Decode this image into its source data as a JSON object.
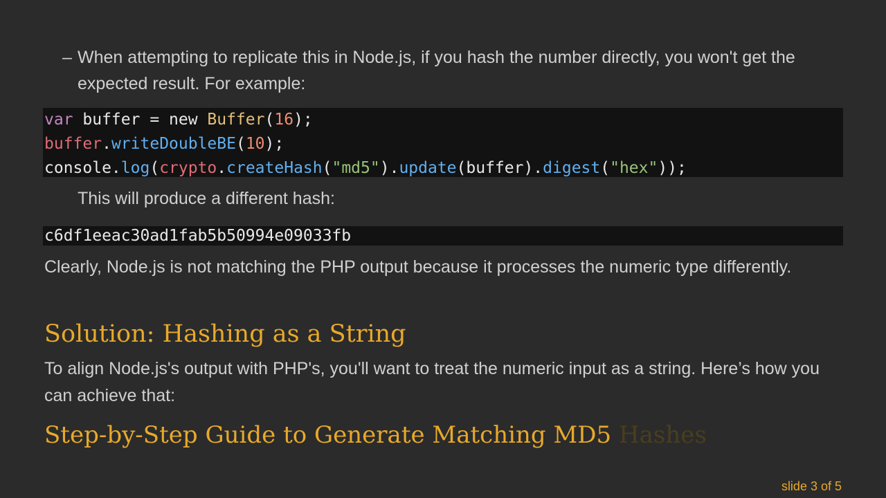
{
  "bullet": {
    "dash": "–",
    "text": "When attempting to replicate this in Node.js, if you hash the number directly, you won't get the expected result. For example:"
  },
  "code_block_1": {
    "line1": {
      "kw": "var",
      "p1": " buffer = new ",
      "cls": "Buffer",
      "p2": "(",
      "num": "16",
      "p3": ");"
    },
    "line2": {
      "obj": "buffer",
      "dot": ".",
      "fn": "writeDoubleBE",
      "p1": "(",
      "num": "10",
      "p2": ");"
    },
    "line3": {
      "a": "console.",
      "b": "log",
      "c": "(",
      "d": "crypto",
      "e": ".",
      "f": "createHash",
      "g": "(",
      "h": "\"md5\"",
      "i": ").",
      "j": "update",
      "k": "(buffer).",
      "l": "digest",
      "m": "(",
      "n": "\"hex\"",
      "o": "));"
    }
  },
  "note": "This will produce a different hash:",
  "hash_output": "c6df1eeac30ad1fab5b50994e09033fb",
  "paragraph_1": "Clearly, Node.js is not matching the PHP output because it processes the numeric type differently.",
  "heading_1": "Solution: Hashing as a String",
  "paragraph_2": "To align Node.js's output with PHP's, you'll want to treat the numeric input as a string. Here’s how you can achieve that:",
  "heading_2": {
    "visible": "Step-by-Step Guide to Generate Matching MD5",
    "faded": "Hashes"
  },
  "slide_indicator": "slide 3 of 5"
}
